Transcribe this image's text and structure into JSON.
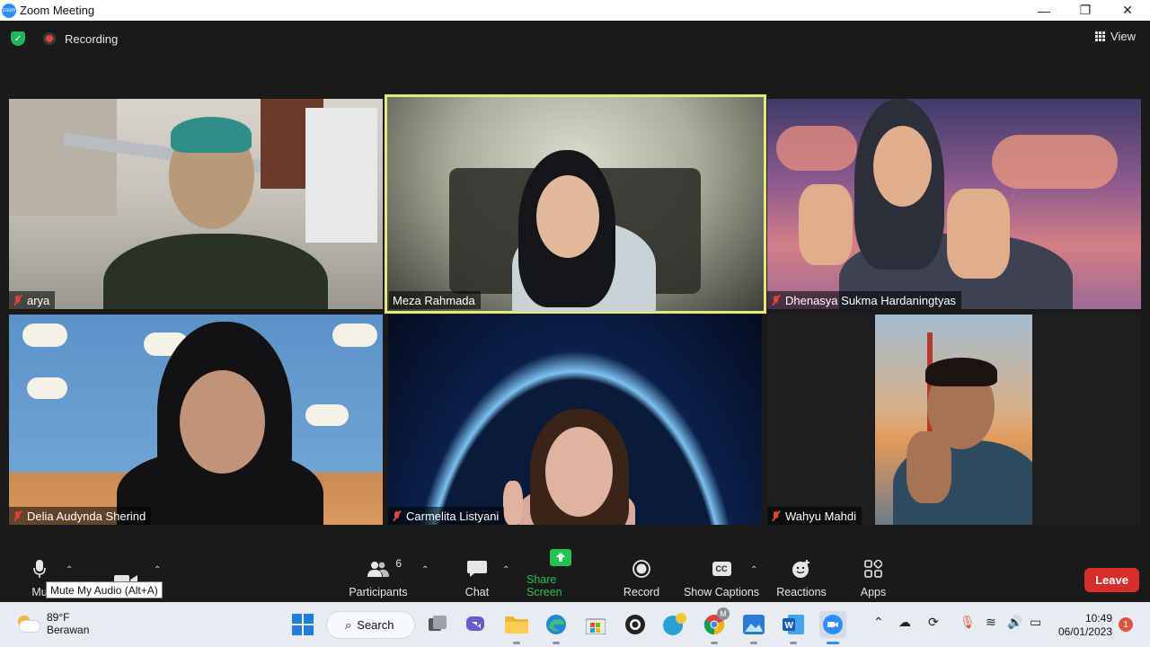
{
  "window": {
    "title": "Zoom Meeting",
    "app_icon_text": "zoom",
    "controls": {
      "minimize": "—",
      "restore": "❐",
      "close": "✕"
    }
  },
  "meeting_header": {
    "recording_label": "Recording",
    "view_label": "View"
  },
  "participants": [
    {
      "name": "arya",
      "muted": true
    },
    {
      "name": "Meza Rahmada",
      "muted": false,
      "active_speaker": true
    },
    {
      "name": "Dhenasya Sukma Hardaningtyas",
      "muted": true
    },
    {
      "name": "Delia Audynda Sherind",
      "muted": true
    },
    {
      "name": "Carmelita Listyani",
      "muted": true
    },
    {
      "name": "Wahyu Mahdi",
      "muted": true
    }
  ],
  "toolbar": {
    "mute_label": "Mu",
    "mute_tooltip": "Mute My Audio (Alt+A)",
    "participants_count": "6",
    "participants_label": "Participants",
    "chat_label": "Chat",
    "share_label": "Share Screen",
    "record_label": "Record",
    "captions_label": "Show Captions",
    "captions_icon_text": "CC",
    "reactions_label": "Reactions",
    "apps_label": "Apps",
    "leave_label": "Leave",
    "caret": "⌃"
  },
  "colors": {
    "share_green": "#23c552",
    "leave_red": "#d92d2b",
    "active_speaker_border": "#e6e97a",
    "recording_red": "#e5413a"
  },
  "taskbar": {
    "weather_temp": "89°F",
    "weather_desc": "Berawan",
    "search_label": "Search",
    "clock_time": "10:49",
    "clock_date": "06/01/2023",
    "notification_count": "1",
    "chrome_badge": "M"
  }
}
